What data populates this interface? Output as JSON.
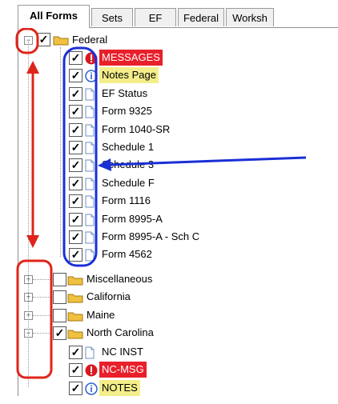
{
  "tabs": [
    {
      "label": "All Forms",
      "active": true
    },
    {
      "label": "Sets",
      "active": false
    },
    {
      "label": "EF",
      "active": false
    },
    {
      "label": "Federal",
      "active": false
    },
    {
      "label": "Worksh",
      "active": false
    }
  ],
  "tree": {
    "federal": {
      "label": "Federal",
      "checked": true,
      "expanded": true,
      "children": [
        {
          "label": "MESSAGES",
          "icon": "alert-icon",
          "style": "msg",
          "checked": true
        },
        {
          "label": "Notes Page",
          "icon": "info-icon",
          "style": "notes",
          "checked": true
        },
        {
          "label": "EF Status",
          "icon": "document-icon",
          "style": "",
          "checked": true
        },
        {
          "label": "Form 9325",
          "icon": "document-icon",
          "style": "",
          "checked": true
        },
        {
          "label": "Form 1040-SR",
          "icon": "document-icon",
          "style": "",
          "checked": true
        },
        {
          "label": "Schedule 1",
          "icon": "document-icon",
          "style": "",
          "checked": true
        },
        {
          "label": "Schedule 3",
          "icon": "document-icon",
          "style": "",
          "checked": true
        },
        {
          "label": "Schedule F",
          "icon": "document-icon",
          "style": "",
          "checked": true
        },
        {
          "label": "Form 1116",
          "icon": "document-icon",
          "style": "",
          "checked": true
        },
        {
          "label": "Form 8995-A",
          "icon": "document-icon",
          "style": "",
          "checked": true
        },
        {
          "label": "Form 8995-A - Sch C",
          "icon": "document-icon",
          "style": "",
          "checked": true
        },
        {
          "label": "Form 4562",
          "icon": "document-icon",
          "style": "",
          "checked": true
        }
      ]
    },
    "other_folders": [
      {
        "label": "Miscellaneous",
        "checked": false,
        "expanded": false
      },
      {
        "label": "California",
        "checked": false,
        "expanded": false
      },
      {
        "label": "Maine",
        "checked": false,
        "expanded": false
      },
      {
        "label": "North Carolina",
        "checked": true,
        "expanded": true
      }
    ],
    "nc_children": [
      {
        "label": "NC INST",
        "icon": "document-icon",
        "style": "",
        "checked": true
      },
      {
        "label": "NC-MSG",
        "icon": "alert-icon",
        "style": "msg",
        "checked": true
      },
      {
        "label": "NOTES",
        "icon": "info-icon",
        "style": "notes",
        "checked": true
      }
    ]
  },
  "annotation_colors": {
    "red": "#e0241b",
    "blue": "#1a2fd6"
  },
  "colors": {
    "message_bg": "#e8202a",
    "notes_bg": "#f3ee8a",
    "folder": "#f0c040"
  }
}
